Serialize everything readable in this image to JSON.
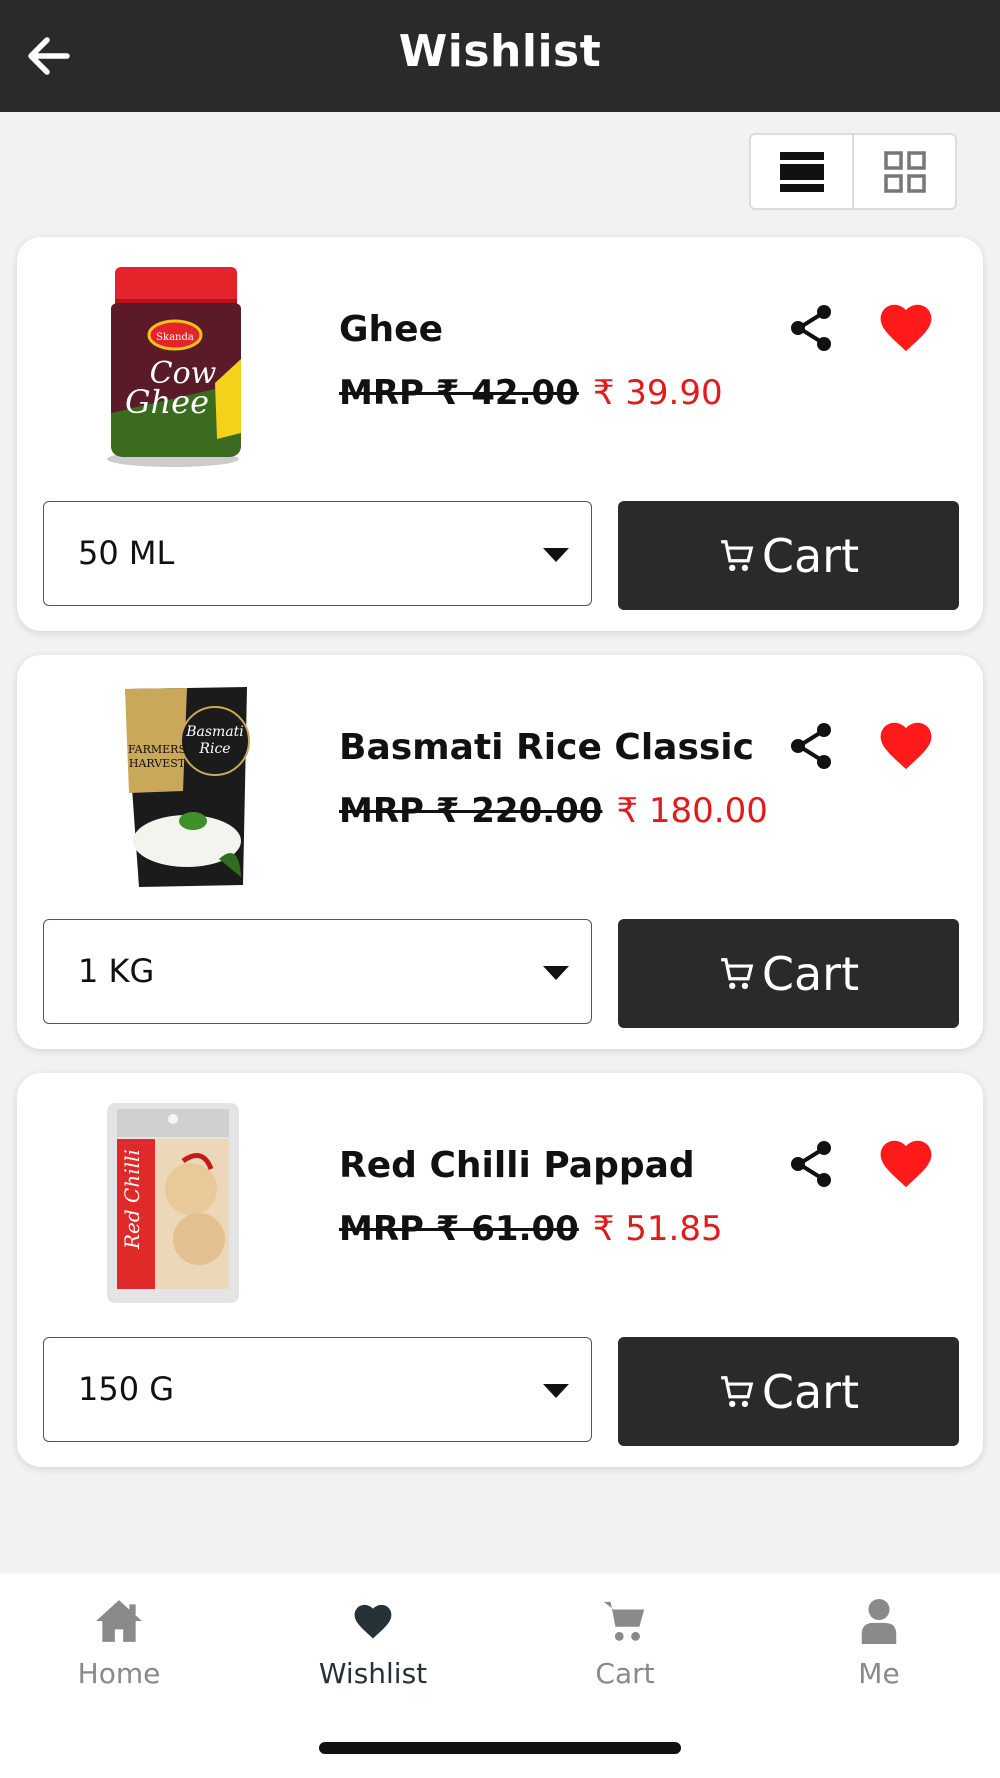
{
  "header": {
    "title": "Wishlist"
  },
  "currency_symbol": "₹",
  "colors": {
    "appbar": "#2a2a2a",
    "price": "#e01b1b",
    "heart": "#ff1a1a",
    "cart_button": "#2a2a2a"
  },
  "products": [
    {
      "name": "Ghee",
      "mrp_text": "MRP ₹ 42.00",
      "price_text": "₹ 39.90",
      "variant": "50 ML",
      "cart_label": "Cart",
      "image": "ghee-jar"
    },
    {
      "name": "Basmati Rice Classic",
      "mrp_text": "MRP ₹ 220.00",
      "price_text": "₹ 180.00",
      "variant": "1 KG",
      "cart_label": "Cart",
      "image": "rice-pouch"
    },
    {
      "name": "Red Chilli Pappad",
      "mrp_text": "MRP ₹ 61.00",
      "price_text": "₹ 51.85",
      "variant": "150 G",
      "cart_label": "Cart",
      "image": "pappad-pack"
    }
  ],
  "bottom_nav": {
    "items": [
      {
        "label": "Home",
        "icon": "home-icon",
        "active": false
      },
      {
        "label": "Wishlist",
        "icon": "heart-icon",
        "active": true
      },
      {
        "label": "Cart",
        "icon": "cart-icon",
        "active": false
      },
      {
        "label": "Me",
        "icon": "person-icon",
        "active": false
      }
    ]
  }
}
